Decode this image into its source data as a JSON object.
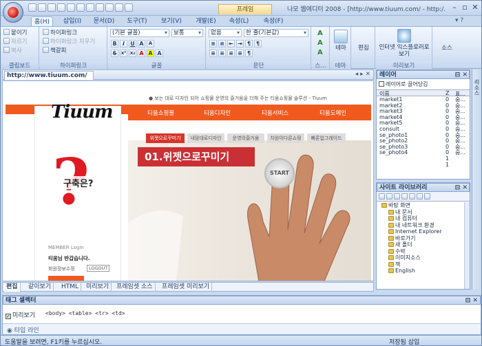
{
  "window": {
    "title": "나모 웹에디터 2008 - [http://www.tiuum.com/ - http:/...",
    "context_tab": "프레임"
  },
  "ribbon_tabs": [
    {
      "label": "홈(H)",
      "active": true
    },
    {
      "label": "삽입(I)"
    },
    {
      "label": "문서(D)"
    },
    {
      "label": "도구(T)"
    },
    {
      "label": "보기(V)"
    },
    {
      "label": "개발(E)"
    },
    {
      "label": "속성(L)"
    },
    {
      "label": "속성(F)"
    }
  ],
  "ribbon": {
    "clipboard": {
      "label": "클립보드",
      "items": [
        "붙이기",
        "자르기",
        "복사"
      ]
    },
    "hyperlink": {
      "label": "하이퍼링크",
      "items": [
        "하이퍼링크",
        "하이퍼링크 지우기",
        "책갈피"
      ]
    },
    "font": {
      "label": "글꼴",
      "face": "(기본 글꼴)",
      "size": "보통",
      "buttons": [
        "B",
        "I",
        "U",
        "A",
        "A",
        "S",
        "x²",
        "x₂",
        "A",
        "A",
        "A"
      ]
    },
    "paragraph": {
      "label": "문단",
      "style": "없음",
      "spacing": "한 줄(기본값)"
    },
    "style": {
      "label": "스...",
      "theme": "테마",
      "edit": "편집"
    },
    "theme_group": {
      "label": "테마"
    },
    "preview": {
      "label": "미리보기",
      "button": "인터넷 익스플로러로 보기"
    },
    "source": {
      "label": "소스"
    }
  },
  "document": {
    "tab": "http://www.tiuum.com/"
  },
  "webpage": {
    "logo": "Tiuum",
    "tagline": "● 보는 대로 디자인 되어 쇼핑몰 운영의 즐거움을 더해 주는 티움쇼핑몰 솔루션 - Tiuum",
    "nav": [
      "티움쇼핑몰",
      "티움디자인",
      "티움서비스",
      "티움도메인"
    ],
    "subnav": [
      "위젯으로꾸미기",
      "내맘대로디자인",
      "운영의즐거움",
      "차원이다른쇼핑",
      "빠른업그레이드"
    ],
    "headline": "01.위젯으로꾸미기",
    "question": "구축은?",
    "start": "START",
    "member_title": "MEMBER Login",
    "member_greeting": "티움님 반갑습니다.",
    "member_link": "회원정보수정",
    "logout": "LOGOUT"
  },
  "bottom_tabs": [
    {
      "label": "편집",
      "active": true
    },
    {
      "label": "같이보기"
    },
    {
      "label": "HTML"
    },
    {
      "label": "미리보기"
    },
    {
      "label": "프레임셋 소스"
    },
    {
      "label": "프레임셋 미리보기"
    }
  ],
  "layer_panel": {
    "title": "레이어",
    "checkbox": "레이어로 끌어당김",
    "col_name": "이름",
    "col_z": "Z",
    "col_vis": "표...",
    "rows": [
      {
        "name": "market1",
        "z": "0",
        "v": "숨..."
      },
      {
        "name": "market2",
        "z": "0",
        "v": "숨..."
      },
      {
        "name": "market3",
        "z": "0",
        "v": "숨..."
      },
      {
        "name": "market4",
        "z": "0",
        "v": "숨..."
      },
      {
        "name": "market5",
        "z": "0",
        "v": "숨..."
      },
      {
        "name": "consult",
        "z": "0",
        "v": "숨..."
      },
      {
        "name": "se_photo1",
        "z": "0",
        "v": "숨..."
      },
      {
        "name": "se_photo2",
        "z": "0",
        "v": "숨..."
      },
      {
        "name": "se_photo3",
        "z": "0",
        "v": "숨..."
      },
      {
        "name": "se_photo4",
        "z": "0",
        "v": "숨..."
      },
      {
        "name": "",
        "z": "1",
        "v": ""
      },
      {
        "name": "",
        "z": "1",
        "v": ""
      }
    ]
  },
  "site_panel": {
    "title": "사이트 라이브러리",
    "tree": [
      "바탕 화면",
      "내 문서",
      "내 컴퓨터",
      "내 네트워크 환경",
      "Internet Explorer",
      "바로가기",
      "새 폴더",
      "수박",
      "이미지소스",
      "책",
      "English"
    ]
  },
  "right_strip": {
    "label": "리소스"
  },
  "tag_panel": {
    "title": "태그 셀렉터",
    "preview_label": "미리보기",
    "tags": "<body> <table> <tr> <td>",
    "type_line": "타입 라인"
  },
  "status": {
    "left": "도움말을 보려면, F1키를 누르십시오.",
    "right": "저장됨  삽입"
  },
  "colors": {
    "orange": "#f05a1e",
    "ribbon": "#dbe6f6",
    "accent": "#15428b"
  }
}
